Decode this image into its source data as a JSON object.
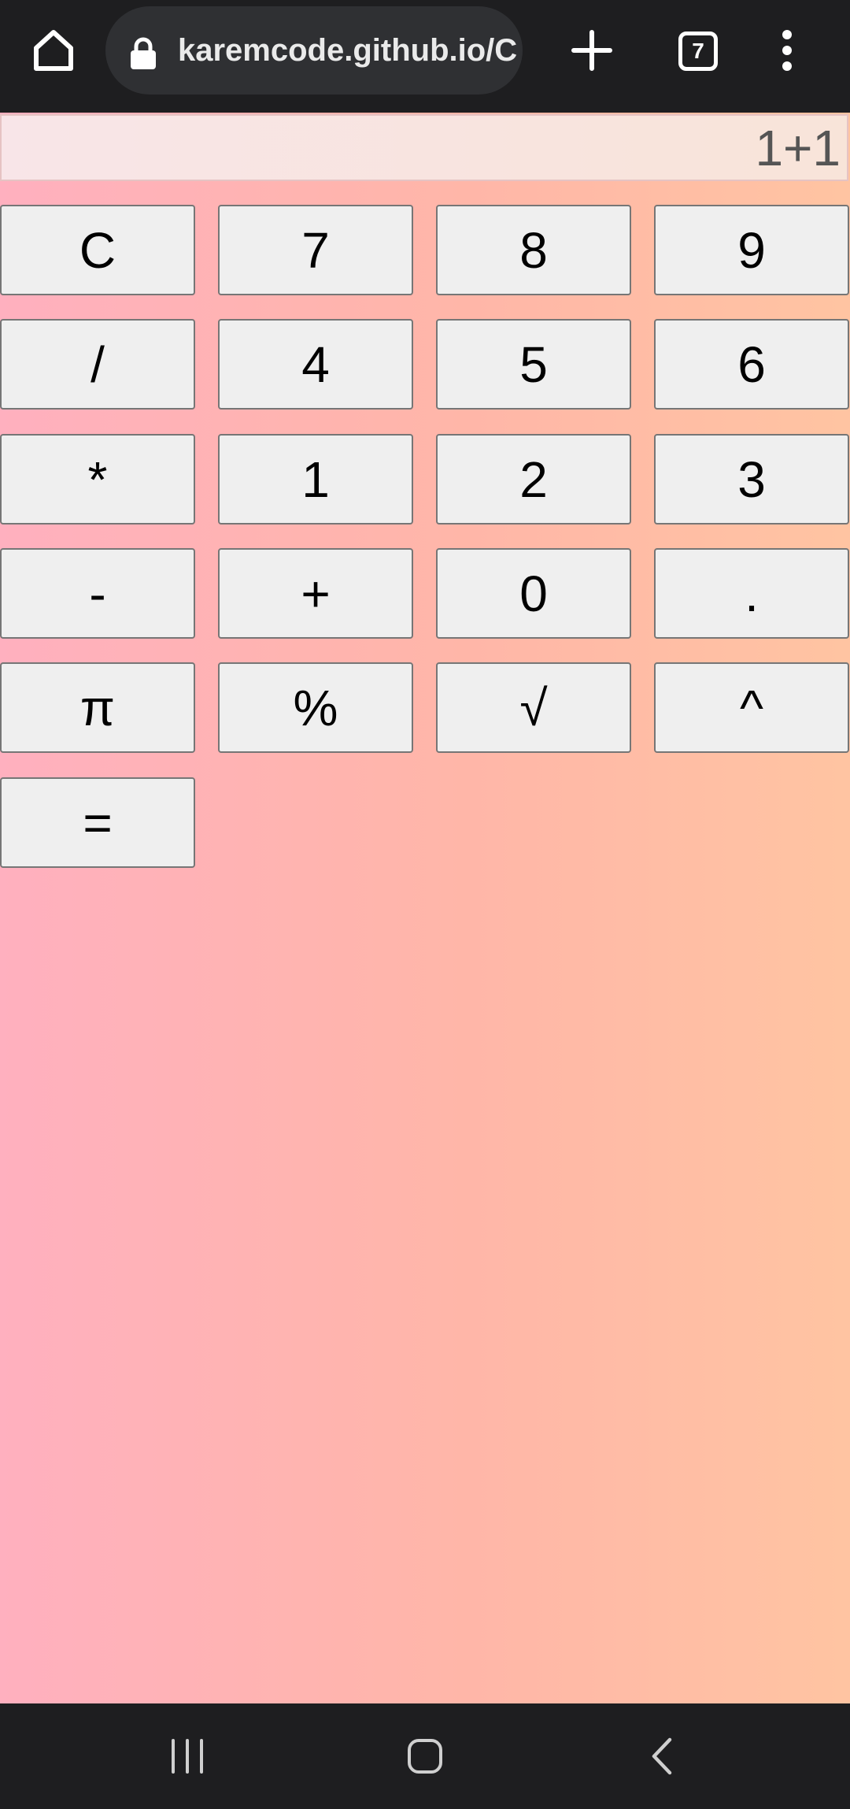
{
  "browser": {
    "url": "karemcode.github.io/Calculator",
    "tab_count": "7",
    "icons": {
      "home": "home-icon",
      "lock": "lock-icon",
      "new_tab": "plus-icon",
      "menu": "kebab-menu-icon"
    }
  },
  "calculator": {
    "display_value": "1+1",
    "keys": {
      "clear": "C",
      "seven": "7",
      "eight": "8",
      "nine": "9",
      "divide": "/",
      "four": "4",
      "five": "5",
      "six": "6",
      "multiply": "*",
      "one": "1",
      "two": "2",
      "three": "3",
      "subtract": "-",
      "add": "+",
      "zero": "0",
      "decimal": ".",
      "pi": "π",
      "percent": "%",
      "sqrt": "√",
      "power": "^",
      "equals": "="
    }
  },
  "system_nav": {
    "icons": {
      "recents": "recents-icon",
      "home": "home-circle-icon",
      "back": "back-chevron-icon"
    }
  },
  "colors": {
    "browser_bar": "#1e1e20",
    "url_pill": "#2f3033",
    "gradient_left": "#ffb0bf",
    "gradient_right": "#ffc4a2",
    "key_face": "#efefef",
    "key_border": "#767676"
  }
}
